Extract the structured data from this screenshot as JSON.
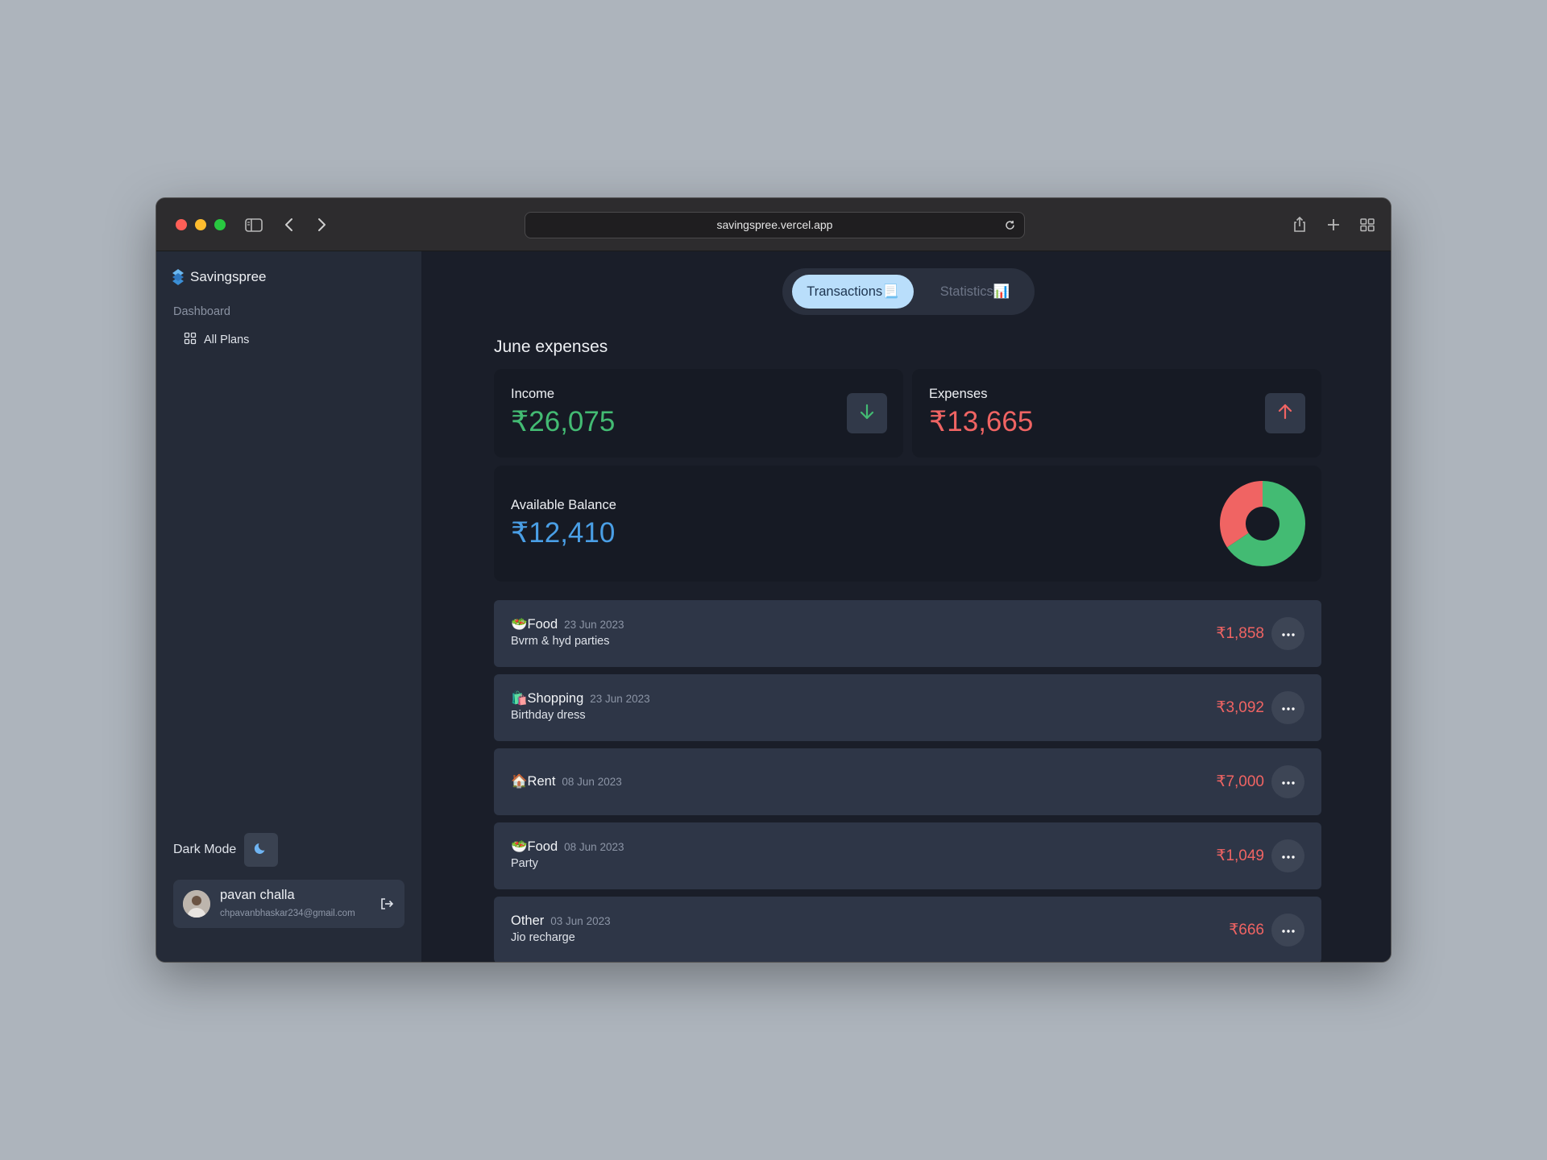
{
  "browser": {
    "url": "savingspree.vercel.app"
  },
  "sidebar": {
    "app_name": "Savingspree",
    "section_label": "Dashboard",
    "items": [
      {
        "label": "All Plans",
        "icon": "grid-icon"
      }
    ],
    "dark_mode_label": "Dark Mode",
    "user": {
      "name": "pavan challa",
      "email": "chpavanbhaskar234@gmail.com"
    }
  },
  "tabs": [
    {
      "label": "Transactions📃",
      "active": true
    },
    {
      "label": "Statistics📊",
      "active": false
    }
  ],
  "page_title": "June expenses",
  "summary": {
    "income": {
      "label": "Income",
      "value": "₹26,075",
      "color": "#43bb73"
    },
    "expenses": {
      "label": "Expenses",
      "value": "₹13,665",
      "color": "#f06463"
    },
    "balance": {
      "label": "Available Balance",
      "value": "₹12,410",
      "color": "#4a9fe6"
    }
  },
  "chart_data": {
    "type": "pie",
    "categories": [
      "Income",
      "Expenses"
    ],
    "values": [
      26075,
      13665
    ],
    "colors": [
      "#43bb73",
      "#f06463"
    ],
    "donut": true
  },
  "transactions": [
    {
      "category": "🥗Food",
      "date": "23 Jun 2023",
      "description": "Bvrm & hyd parties",
      "amount": "₹1,858"
    },
    {
      "category": "🛍️Shopping",
      "date": "23 Jun 2023",
      "description": "Birthday dress",
      "amount": "₹3,092"
    },
    {
      "category": "🏠Rent",
      "date": "08 Jun 2023",
      "description": "",
      "amount": "₹7,000"
    },
    {
      "category": "🥗Food",
      "date": "08 Jun 2023",
      "description": "Party",
      "amount": "₹1,049"
    },
    {
      "category": "Other",
      "date": "03 Jun 2023",
      "description": "Jio recharge",
      "amount": "₹666"
    }
  ]
}
